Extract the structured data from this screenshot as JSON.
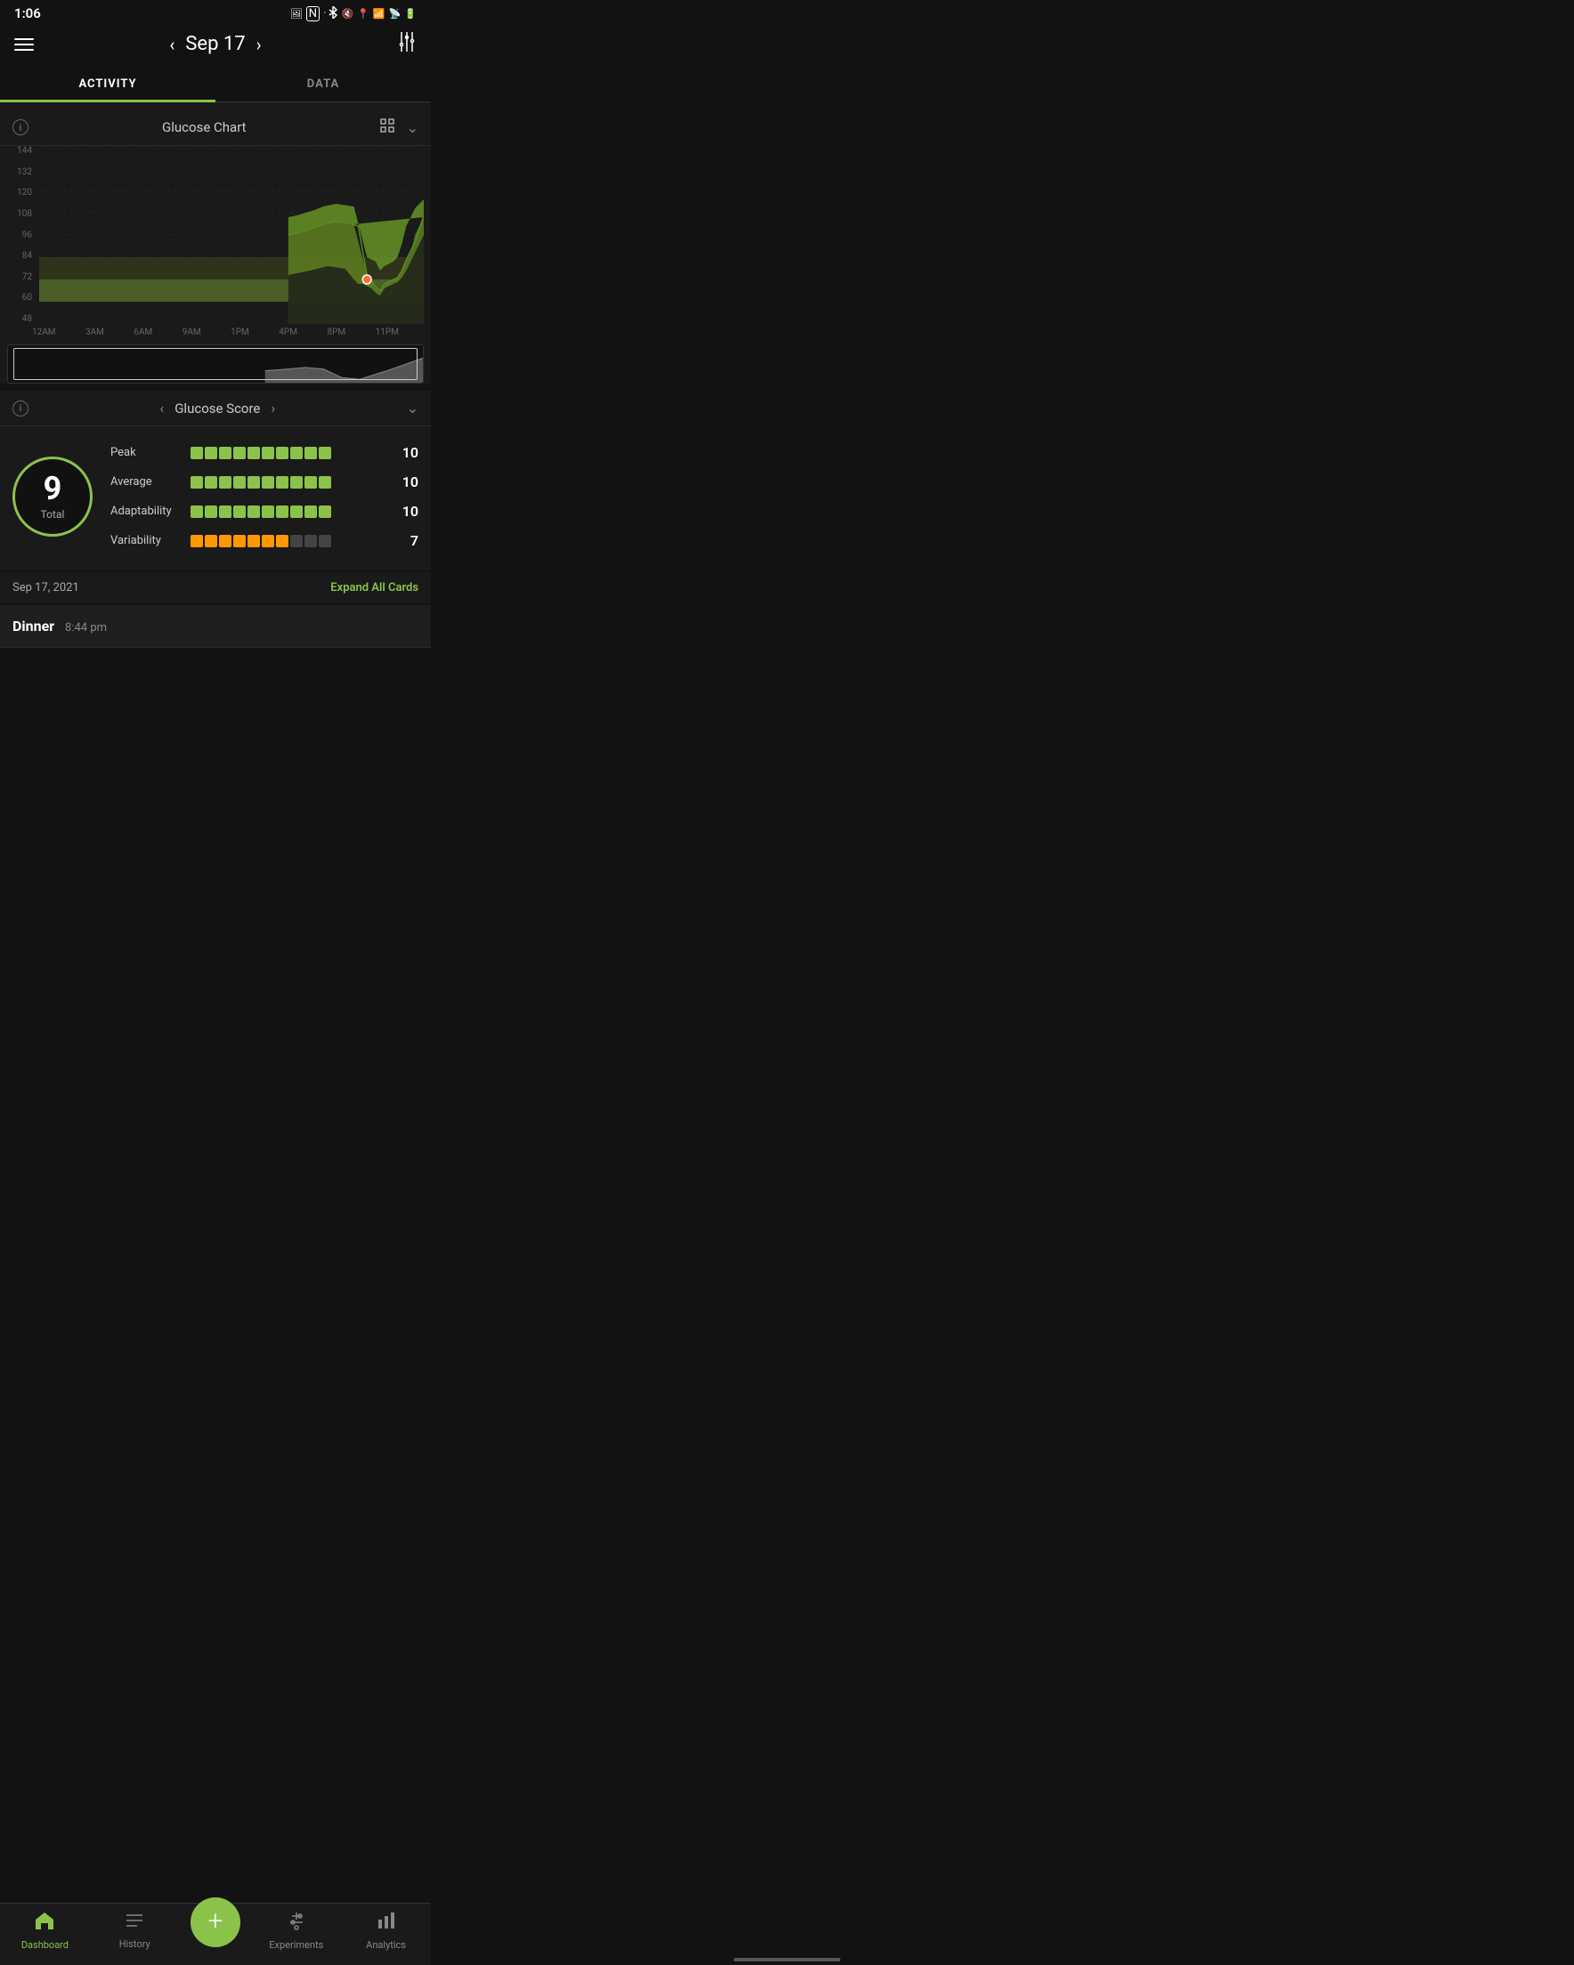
{
  "statusBar": {
    "time": "1:06",
    "icons": [
      "photo",
      "nfc",
      "bluetooth",
      "mute",
      "location",
      "wifi",
      "signal",
      "battery"
    ]
  },
  "header": {
    "menuLabel": "menu",
    "date": "Sep 17",
    "prevArrow": "‹",
    "nextArrow": "›",
    "settingsLabel": "settings"
  },
  "tabs": [
    {
      "id": "activity",
      "label": "ACTIVITY",
      "active": true
    },
    {
      "id": "data",
      "label": "DATA",
      "active": false
    }
  ],
  "glucoseChart": {
    "title": "Glucose Chart",
    "yLabels": [
      "144",
      "132",
      "120",
      "108",
      "96",
      "84",
      "72",
      "60",
      "48"
    ],
    "xLabels": [
      "12AM",
      "3AM",
      "6AM",
      "9AM",
      "1PM",
      "4PM",
      "8PM",
      "11PM"
    ]
  },
  "glucoseScore": {
    "title": "Glucose Score",
    "totalScore": "9",
    "totalLabel": "Total",
    "metrics": [
      {
        "name": "Peak",
        "value": "10",
        "bars": 10,
        "filledBars": 10,
        "color": "green"
      },
      {
        "name": "Average",
        "value": "10",
        "bars": 10,
        "filledBars": 10,
        "color": "green"
      },
      {
        "name": "Adaptability",
        "value": "10",
        "bars": 10,
        "filledBars": 10,
        "color": "green"
      },
      {
        "name": "Variability",
        "value": "7",
        "bars": 10,
        "filledBars": 7,
        "color": "orange"
      }
    ]
  },
  "dateSection": {
    "date": "Sep 17, 2021",
    "expandAll": "Expand All Cards"
  },
  "activityCard": {
    "title": "Dinner",
    "time": "8:44 pm"
  },
  "bottomNav": {
    "items": [
      {
        "id": "dashboard",
        "label": "Dashboard",
        "icon": "🏠",
        "active": true
      },
      {
        "id": "history",
        "label": "History",
        "icon": "☰",
        "active": false
      },
      {
        "id": "add",
        "label": "",
        "icon": "+",
        "isAdd": true
      },
      {
        "id": "experiments",
        "label": "Experiments",
        "icon": "⚙",
        "active": false
      },
      {
        "id": "analytics",
        "label": "Analytics",
        "icon": "📊",
        "active": false
      }
    ]
  },
  "colors": {
    "accent": "#8bc34a",
    "background": "#121212",
    "card": "#1a1a1a",
    "orange": "#ff9800",
    "gray": "#444",
    "text": "#ccc",
    "dimText": "#888"
  }
}
